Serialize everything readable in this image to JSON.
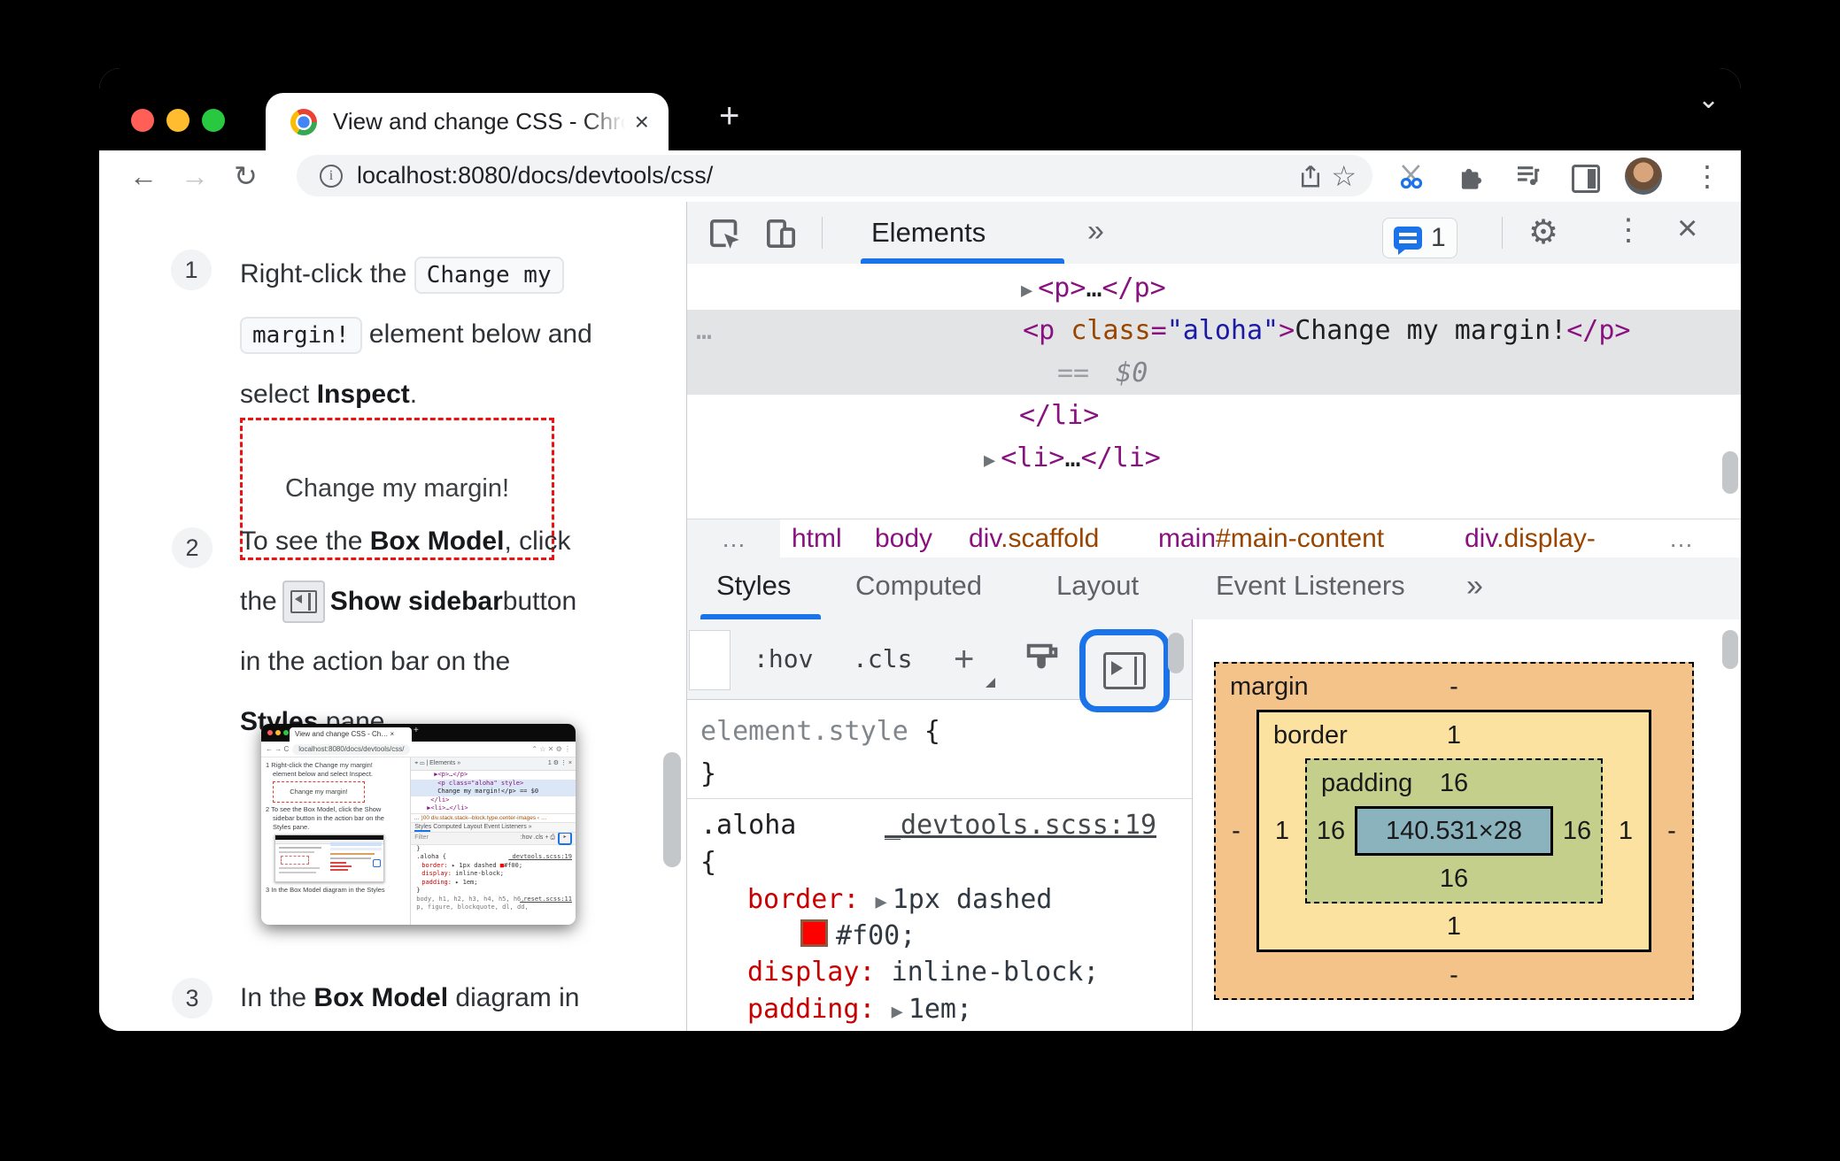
{
  "chrome": {
    "tab_title": "View and change CSS - Chrom",
    "tab_close": "×",
    "new_tab": "+",
    "menu_chevron": "⌄",
    "back": "←",
    "forward": "→",
    "reload": "↻",
    "info_glyph": "i",
    "url": "localhost:8080/docs/devtools/css/",
    "overflow": "⋮"
  },
  "doc": {
    "s1_num": "1",
    "s1_l1a": "Right-click the ",
    "s1_code1": "Change my",
    "s1_code2": "margin!",
    "s1_l2b": " element below and",
    "s1_l3a": "select ",
    "s1_l3b": "Inspect",
    "s1_l3c": ".",
    "s1_demo": "Change my margin!",
    "s2_num": "2",
    "s2_l1a": "To see the ",
    "s2_l1b": "Box Model",
    "s2_l1c": ", click",
    "s2_l2a": "the ",
    "s2_l2b": " Show sidebar",
    "s2_l2c": " button",
    "s2_l3": "in the action bar on the",
    "s2_l4a": "Styles",
    "s2_l4b": " pane.",
    "s3_num": "3",
    "s3_l1a": "In the ",
    "s3_l1b": "Box Model",
    "s3_l1c": " diagram in"
  },
  "thumb": {
    "tab_title": "View and change CSS - Ch…  ×",
    "new_tab": "+",
    "nav": "←  →  C",
    "url": "localhost:8080/docs/devtools/css/",
    "tool_icons": "⌃ ☆ ✕ ⚙ ⋮",
    "doc1": "1  Right-click the Change my margin!",
    "doc2": "element below and select Inspect.",
    "doc_demo": "Change my margin!",
    "doc3": "2  To see the Box Model, click the Show",
    "doc4": "sidebar button in the action bar on the",
    "doc5": "Styles pane.",
    "doc6": "3  In the Box Model diagram in the Styles",
    "dev_head": "⌖ ▭ | Elements  »",
    "dev_badge": "1 ⚙ ⋮ ×",
    "code1": "▶<p>…</p>",
    "code2": "<p class=\"aloha\" style>",
    "code3": "Change my margin!</p> == $0",
    "code4": "</li>",
    "code5": "▶<li>…</li>",
    "crumbs": "… )00  div.stack.stack--block.type.center-images  ‹ …",
    "tabs": "Styles  Computed  Layout  Event Listeners  »",
    "filter": "Filter",
    "filter_right": ":hov  .cls  +  ⎙",
    "ring_glyph": "▸",
    "r0": "}",
    "r1": ".aloha {",
    "r1_link": "_devtools.scss:19",
    "r2a": "border:",
    "r2b": " ▸ 1px dashed ",
    "r2sw": "■",
    "r2c": "#f00;",
    "r3a": "display:",
    "r3b": " inline-block;",
    "r4a": "padding:",
    "r4b": " ▸ 1em;",
    "r5": "}",
    "r6": "body, h1, h2, h3, h4, h5, h6,",
    "r6_link": "_reset.scss:11",
    "r7": "p, figure, blockquote, dl, dd,"
  },
  "devtools": {
    "tab_elements": "Elements",
    "more_tabs": "»",
    "issues_count": "1",
    "close": "×",
    "overflow": "⋮",
    "gear": "⚙",
    "dom_arrow": "▶",
    "dom1_open": "<p>",
    "dom1_ellipsis": "…",
    "dom1_close": "</p>",
    "dom2_dots": "…",
    "dom2_open": "<p ",
    "dom2_attr": "class",
    "dom2_eq": "=",
    "dom2_val": "\"aloha\"",
    "dom2_gt": ">",
    "dom2_text": "Change my margin!",
    "dom2_close": "</p>",
    "dom2_flag_eq": "==",
    "dom2_flag": "$0",
    "dom3": "</li>",
    "dom4_open": "<li>",
    "dom4_ellipsis": "…",
    "dom4_close": "</li>",
    "crumb_dots": "…",
    "crumbs": [
      {
        "tag": "html",
        "suffix": ""
      },
      {
        "tag": "body",
        "suffix": ""
      },
      {
        "tag": "div",
        "suffix": ".scaffold"
      },
      {
        "tag": "main",
        "suffix": "#main-content"
      },
      {
        "tag": "div",
        "suffix": ".display-"
      }
    ],
    "panel_tabs": [
      "Styles",
      "Computed",
      "Layout",
      "Event Listeners"
    ],
    "panel_more": "»",
    "hov": ":hov",
    "cls": ".cls",
    "plus": "+",
    "elem_style": "element.style",
    "elem_open": "{",
    "elem_close": "}",
    "selector": ".aloha",
    "sel_link": "_devtools.scss:19",
    "sel_open": "{",
    "p1_name": "border:",
    "p1_arrow": "▶",
    "p1_val": "1px dashed",
    "p1_val2": "#f00;",
    "p2_name": "display:",
    "p2_val": "inline-block;",
    "p3_name": "padding:",
    "p3_arrow": "▶",
    "p3_val": "1em;"
  },
  "boxmodel": {
    "margin_label": "margin",
    "border_label": "border",
    "padding_label": "padding",
    "content": "140.531×28",
    "m_top": "-",
    "m_left": "-",
    "m_right": "-",
    "m_bottom": "-",
    "b_top": "1",
    "b_left": "1",
    "b_right": "1",
    "b_bottom": "1",
    "p_top": "16",
    "p_left": "16",
    "p_right": "16",
    "p_bottom": "16"
  },
  "colors": {
    "accent_blue": "#1a73e8",
    "swatch_red": "#f00",
    "margin_bg": "#f3c38a",
    "border_bg": "#fbe2a0",
    "padding_bg": "#c3cf8b",
    "content_bg": "#8ab3bd"
  }
}
